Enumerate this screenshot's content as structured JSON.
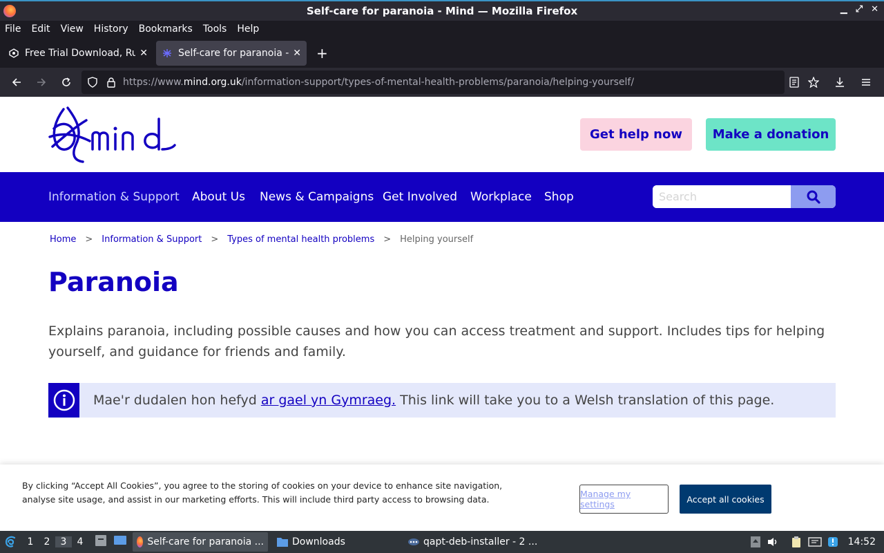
{
  "window": {
    "title": "Self-care for paranoia - Mind — Mozilla Firefox"
  },
  "menu": [
    "File",
    "Edit",
    "View",
    "History",
    "Bookmarks",
    "Tools",
    "Help"
  ],
  "tabs": [
    {
      "title": "Free Trial Download, Run",
      "active": false
    },
    {
      "title": "Self-care for paranoia - Mind",
      "active": true
    }
  ],
  "urlbar": {
    "prefix": "https://www.",
    "domain": "mind.org.uk",
    "path": "/information-support/types-of-mental-health-problems/paranoia/helping-yourself/"
  },
  "header": {
    "help_button": "Get help now",
    "donate_button": "Make a donation"
  },
  "nav": {
    "items": [
      "Information & Support",
      "About Us",
      "News & Campaigns",
      "Get Involved",
      "Workplace",
      "Shop"
    ],
    "search_placeholder": "Search"
  },
  "breadcrumb": {
    "items": [
      "Home",
      "Information & Support",
      "Types of mental health problems"
    ],
    "separator": ">",
    "current": "Helping yourself"
  },
  "page": {
    "title": "Paranoia",
    "intro": "Explains paranoia, including possible causes and how you can access treatment and support. Includes tips for helping yourself, and guidance for friends and family.",
    "welsh_prefix": "Mae'r dudalen hon hefyd ",
    "welsh_link": "ar gael yn Gymraeg.",
    "welsh_suffix": " This link will take you to a Welsh translation of this page."
  },
  "cookie": {
    "text": "By clicking “Accept All Cookies”, you agree to the storing of cookies on your device to enhance site navigation, analyse site usage, and assist in our marketing efforts. This will include third party access to browsing data.",
    "manage_label": "Manage my settings",
    "accept_label": "Accept all cookies"
  },
  "taskbar": {
    "workspaces": [
      "1",
      "2",
      "3",
      "4"
    ],
    "active_workspace": "3",
    "tasks": [
      "Self-care for paranoia ...",
      "Downloads",
      "qapt-deb-installer - 2 ..."
    ],
    "clock": "14:52"
  },
  "colors": {
    "brand_blue": "#1300c1",
    "help_pink": "#fbd4e0",
    "donate_green": "#6de4c7",
    "accept_navy": "#003a70"
  }
}
